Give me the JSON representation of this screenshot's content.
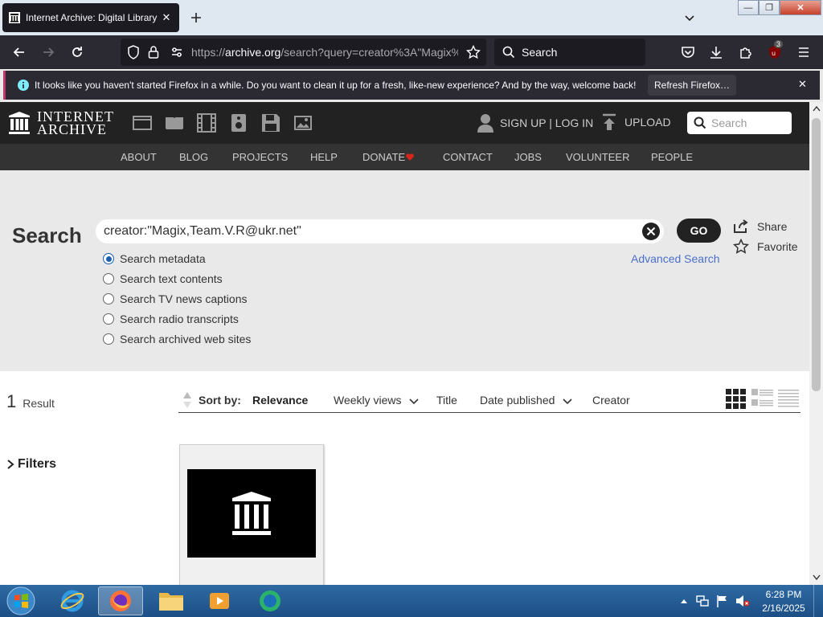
{
  "browser": {
    "tab_title": "Internet Archive: Digital Library",
    "tab_close": "✕",
    "new_tab": "+",
    "url_prefix": "https://",
    "url_domain": "archive.org",
    "url_rest": "/search?query=creator%3A\"Magix%",
    "search_placeholder": "Search",
    "extension_badge": "3",
    "notification": "It looks like you haven't started Firefox in a while. Do you want to clean it up for a fresh, like-new experience? And by the way, welcome back!",
    "notification_button": "Refresh Firefox…",
    "notification_close": "✕",
    "window_controls": {
      "minimize": "—",
      "maximize": "❐",
      "close": "✕"
    }
  },
  "ia": {
    "logo_line1": "INTERNET",
    "logo_line2": "ARCHIVE",
    "signin": "SIGN UP | LOG IN",
    "upload": "UPLOAD",
    "search_placeholder": "Search",
    "nav": [
      "ABOUT",
      "BLOG",
      "PROJECTS",
      "HELP",
      "DONATE",
      "CONTACT",
      "JOBS",
      "VOLUNTEER",
      "PEOPLE"
    ],
    "donate_heart_color": "#d9261c"
  },
  "search": {
    "heading": "Search",
    "query": "creator:\"Magix,Team.V.R@ukr.net\"",
    "go": "GO",
    "share": "Share",
    "favorite": "Favorite",
    "advanced": "Advanced Search",
    "options": [
      {
        "label": "Search metadata",
        "selected": true
      },
      {
        "label": "Search text contents",
        "selected": false
      },
      {
        "label": "Search TV news captions",
        "selected": false
      },
      {
        "label": "Search radio transcripts",
        "selected": false
      },
      {
        "label": "Search archived web sites",
        "selected": false
      }
    ]
  },
  "results": {
    "count": "1",
    "count_label": "Result",
    "filters": "Filters",
    "sort_label": "Sort by:",
    "sort_options": [
      "Relevance",
      "Weekly views",
      "Title",
      "Date published",
      "Creator"
    ]
  },
  "taskbar": {
    "time": "6:28 PM",
    "date": "2/16/2025"
  },
  "colors": {
    "accent_link": "#4a6fcc",
    "notification_border": "#c0366b"
  }
}
